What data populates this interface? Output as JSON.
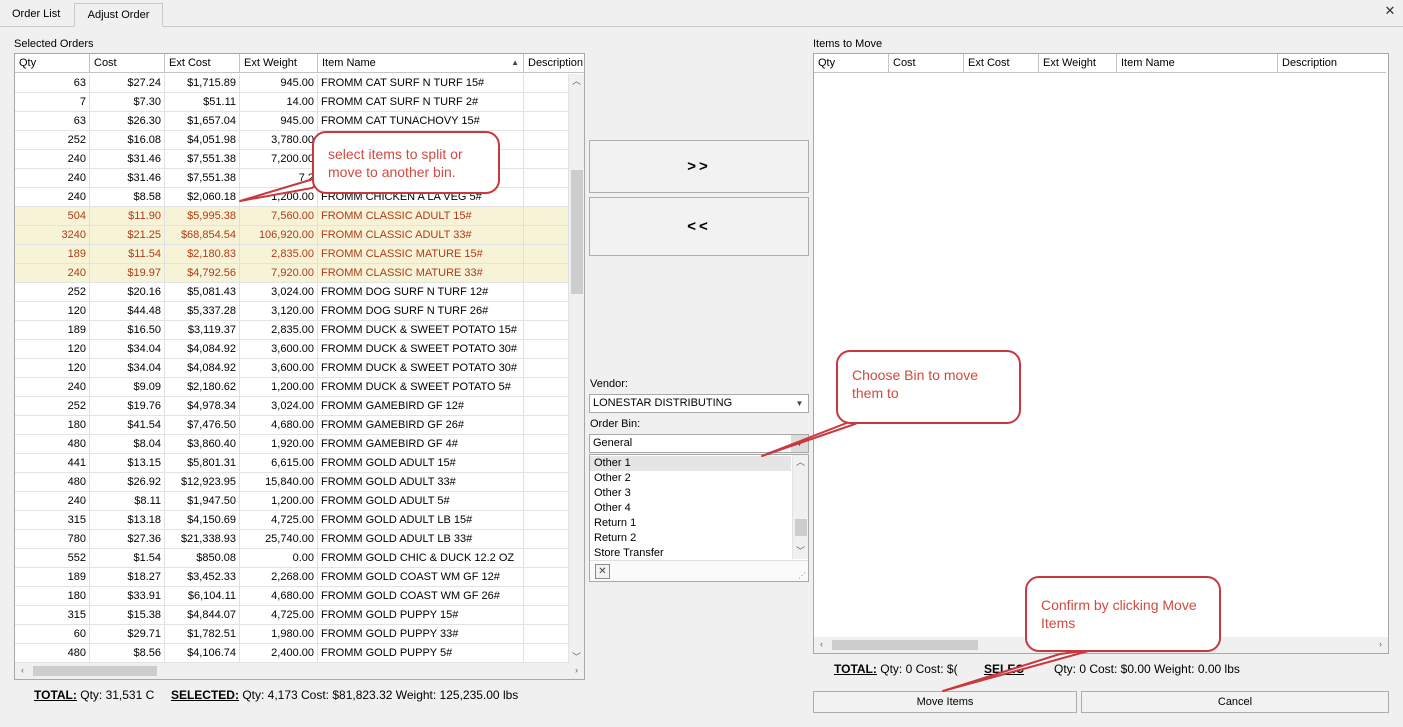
{
  "tabs": [
    {
      "label": "Order List"
    },
    {
      "label": "Adjust Order"
    }
  ],
  "close_glyph": "✕",
  "left_panel": {
    "label": "Selected Orders",
    "columns": [
      "Qty",
      "Cost",
      "Ext Cost",
      "Ext Weight",
      "Item Name",
      "Description"
    ],
    "sorted_column": "Item Name",
    "rows": [
      {
        "qty": "63",
        "cost": "$27.24",
        "ext_cost": "$1,715.89",
        "ext_weight": "945.00",
        "name": "FROMM CAT SURF N TURF 15#",
        "selected": false
      },
      {
        "qty": "7",
        "cost": "$7.30",
        "ext_cost": "$51.11",
        "ext_weight": "14.00",
        "name": "FROMM CAT SURF N TURF 2#",
        "selected": false
      },
      {
        "qty": "63",
        "cost": "$26.30",
        "ext_cost": "$1,657.04",
        "ext_weight": "945.00",
        "name": "FROMM CAT TUNACHOVY 15#",
        "selected": false
      },
      {
        "qty": "252",
        "cost": "$16.08",
        "ext_cost": "$4,051.98",
        "ext_weight": "3,780.00",
        "name": "",
        "selected": false
      },
      {
        "qty": "240",
        "cost": "$31.46",
        "ext_cost": "$7,551.38",
        "ext_weight": "7,200.00",
        "name": "",
        "selected": false
      },
      {
        "qty": "240",
        "cost": "$31.46",
        "ext_cost": "$7,551.38",
        "ext_weight": "7,2",
        "name": "",
        "selected": false
      },
      {
        "qty": "240",
        "cost": "$8.58",
        "ext_cost": "$2,060.18",
        "ext_weight": "1,200.00",
        "name": "FROMM CHICKEN A LA VEG 5#",
        "selected": false
      },
      {
        "qty": "504",
        "cost": "$11.90",
        "ext_cost": "$5,995.38",
        "ext_weight": "7,560.00",
        "name": "FROMM CLASSIC ADULT 15#",
        "selected": true
      },
      {
        "qty": "3240",
        "cost": "$21.25",
        "ext_cost": "$68,854.54",
        "ext_weight": "106,920.00",
        "name": "FROMM CLASSIC ADULT 33#",
        "selected": true
      },
      {
        "qty": "189",
        "cost": "$11.54",
        "ext_cost": "$2,180.83",
        "ext_weight": "2,835.00",
        "name": "FROMM CLASSIC MATURE 15#",
        "selected": true
      },
      {
        "qty": "240",
        "cost": "$19.97",
        "ext_cost": "$4,792.56",
        "ext_weight": "7,920.00",
        "name": "FROMM CLASSIC MATURE 33#",
        "selected": true
      },
      {
        "qty": "252",
        "cost": "$20.16",
        "ext_cost": "$5,081.43",
        "ext_weight": "3,024.00",
        "name": "FROMM DOG SURF N TURF 12#",
        "selected": false
      },
      {
        "qty": "120",
        "cost": "$44.48",
        "ext_cost": "$5,337.28",
        "ext_weight": "3,120.00",
        "name": "FROMM DOG SURF N TURF 26#",
        "selected": false
      },
      {
        "qty": "189",
        "cost": "$16.50",
        "ext_cost": "$3,119.37",
        "ext_weight": "2,835.00",
        "name": "FROMM DUCK & SWEET POTATO 15#",
        "selected": false
      },
      {
        "qty": "120",
        "cost": "$34.04",
        "ext_cost": "$4,084.92",
        "ext_weight": "3,600.00",
        "name": "FROMM DUCK & SWEET POTATO 30#",
        "selected": false
      },
      {
        "qty": "120",
        "cost": "$34.04",
        "ext_cost": "$4,084.92",
        "ext_weight": "3,600.00",
        "name": "FROMM DUCK & SWEET POTATO 30#",
        "selected": false
      },
      {
        "qty": "240",
        "cost": "$9.09",
        "ext_cost": "$2,180.62",
        "ext_weight": "1,200.00",
        "name": "FROMM DUCK & SWEET POTATO 5#",
        "selected": false
      },
      {
        "qty": "252",
        "cost": "$19.76",
        "ext_cost": "$4,978.34",
        "ext_weight": "3,024.00",
        "name": "FROMM GAMEBIRD GF 12#",
        "selected": false
      },
      {
        "qty": "180",
        "cost": "$41.54",
        "ext_cost": "$7,476.50",
        "ext_weight": "4,680.00",
        "name": "FROMM GAMEBIRD GF 26#",
        "selected": false
      },
      {
        "qty": "480",
        "cost": "$8.04",
        "ext_cost": "$3,860.40",
        "ext_weight": "1,920.00",
        "name": "FROMM GAMEBIRD GF 4#",
        "selected": false
      },
      {
        "qty": "441",
        "cost": "$13.15",
        "ext_cost": "$5,801.31",
        "ext_weight": "6,615.00",
        "name": "FROMM GOLD ADULT 15#",
        "selected": false
      },
      {
        "qty": "480",
        "cost": "$26.92",
        "ext_cost": "$12,923.95",
        "ext_weight": "15,840.00",
        "name": "FROMM GOLD ADULT 33#",
        "selected": false
      },
      {
        "qty": "240",
        "cost": "$8.11",
        "ext_cost": "$1,947.50",
        "ext_weight": "1,200.00",
        "name": "FROMM GOLD ADULT 5#",
        "selected": false
      },
      {
        "qty": "315",
        "cost": "$13.18",
        "ext_cost": "$4,150.69",
        "ext_weight": "4,725.00",
        "name": "FROMM GOLD ADULT LB 15#",
        "selected": false
      },
      {
        "qty": "780",
        "cost": "$27.36",
        "ext_cost": "$21,338.93",
        "ext_weight": "25,740.00",
        "name": "FROMM GOLD ADULT LB 33#",
        "selected": false
      },
      {
        "qty": "552",
        "cost": "$1.54",
        "ext_cost": "$850.08",
        "ext_weight": "0.00",
        "name": "FROMM GOLD CHIC & DUCK 12.2 OZ",
        "selected": false
      },
      {
        "qty": "189",
        "cost": "$18.27",
        "ext_cost": "$3,452.33",
        "ext_weight": "2,268.00",
        "name": "FROMM GOLD COAST WM GF 12#",
        "selected": false
      },
      {
        "qty": "180",
        "cost": "$33.91",
        "ext_cost": "$6,104.11",
        "ext_weight": "4,680.00",
        "name": "FROMM GOLD COAST WM GF 26#",
        "selected": false
      },
      {
        "qty": "315",
        "cost": "$15.38",
        "ext_cost": "$4,844.07",
        "ext_weight": "4,725.00",
        "name": "FROMM GOLD PUPPY 15#",
        "selected": false
      },
      {
        "qty": "60",
        "cost": "$29.71",
        "ext_cost": "$1,782.51",
        "ext_weight": "1,980.00",
        "name": "FROMM GOLD PUPPY 33#",
        "selected": false
      },
      {
        "qty": "480",
        "cost": "$8.56",
        "ext_cost": "$4,106.74",
        "ext_weight": "2,400.00",
        "name": "FROMM GOLD PUPPY 5#",
        "selected": false
      }
    ],
    "summary": {
      "total_label": "TOTAL:",
      "total_text": "Qty: 31,531 C",
      "selected_label": "SELECTED:",
      "selected_text": "Qty: 4,173 Cost: $81,823.32 Weight: 125,235.00 lbs"
    }
  },
  "move_buttons": {
    "forward": ">>",
    "back": "<<"
  },
  "vendor": {
    "label": "Vendor:",
    "value": "LONESTAR DISTRIBUTING"
  },
  "order_bin": {
    "label": "Order Bin:",
    "value": "General",
    "options": [
      "Other 1",
      "Other 2",
      "Other 3",
      "Other 4",
      "Return 1",
      "Return 2",
      "Store Transfer"
    ]
  },
  "right_panel": {
    "label": "Items to Move",
    "columns": [
      "Qty",
      "Cost",
      "Ext Cost",
      "Ext Weight",
      "Item Name",
      "Description"
    ],
    "summary": {
      "total_label": "TOTAL:",
      "total_text": "Qty: 0 Cost: $(",
      "selected_label": "SELEC",
      "selected_text": "Qty: 0 Cost: $0.00 Weight: 0.00 lbs"
    }
  },
  "buttons": {
    "move_items": "Move Items",
    "cancel": "Cancel"
  },
  "callouts": {
    "select_items": "select items to split or move to another bin.",
    "choose_bin": "Choose Bin to move them to",
    "confirm": "Confirm by clicking Move Items"
  },
  "colors": {
    "callout_border": "#c9383f",
    "callout_text": "#d14a3f",
    "selected_row_bg": "#f6f3d6",
    "selected_row_text": "#b33b1a"
  }
}
